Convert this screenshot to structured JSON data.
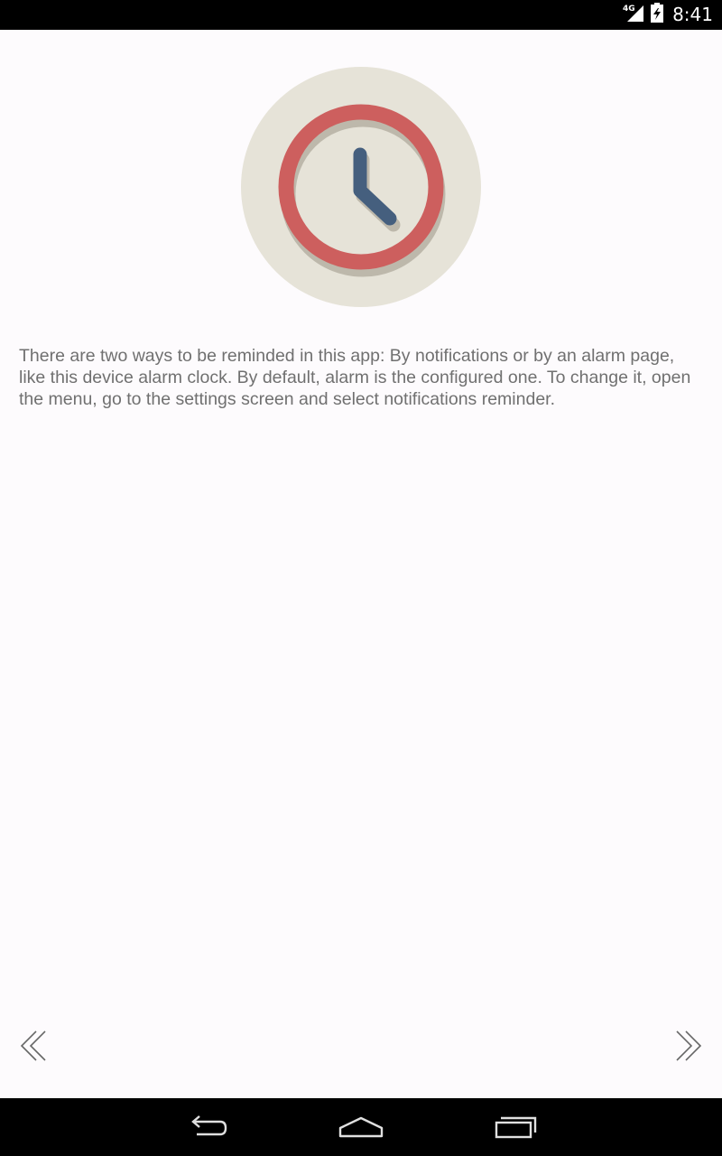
{
  "status_bar": {
    "network": "4G",
    "time": "8:41"
  },
  "illustration": {
    "icon": "alarm-clock-icon",
    "colors": {
      "disc": "#e6e3d8",
      "ring": "#cd5f5e",
      "shadow": "#bdb8ab",
      "hands": "#455f7e"
    }
  },
  "description": "There are two ways to be reminded in this app: By notifications or by an alarm page, like this device alarm clock. By default, alarm is the configured one. To change it, open the menu, go to the settings screen and select notifications reminder.",
  "navigation": {
    "prev_icon": "double-chevron-left-icon",
    "next_icon": "double-chevron-right-icon"
  },
  "system_nav": {
    "back_icon": "back-icon",
    "home_icon": "home-icon",
    "recents_icon": "recents-icon"
  }
}
